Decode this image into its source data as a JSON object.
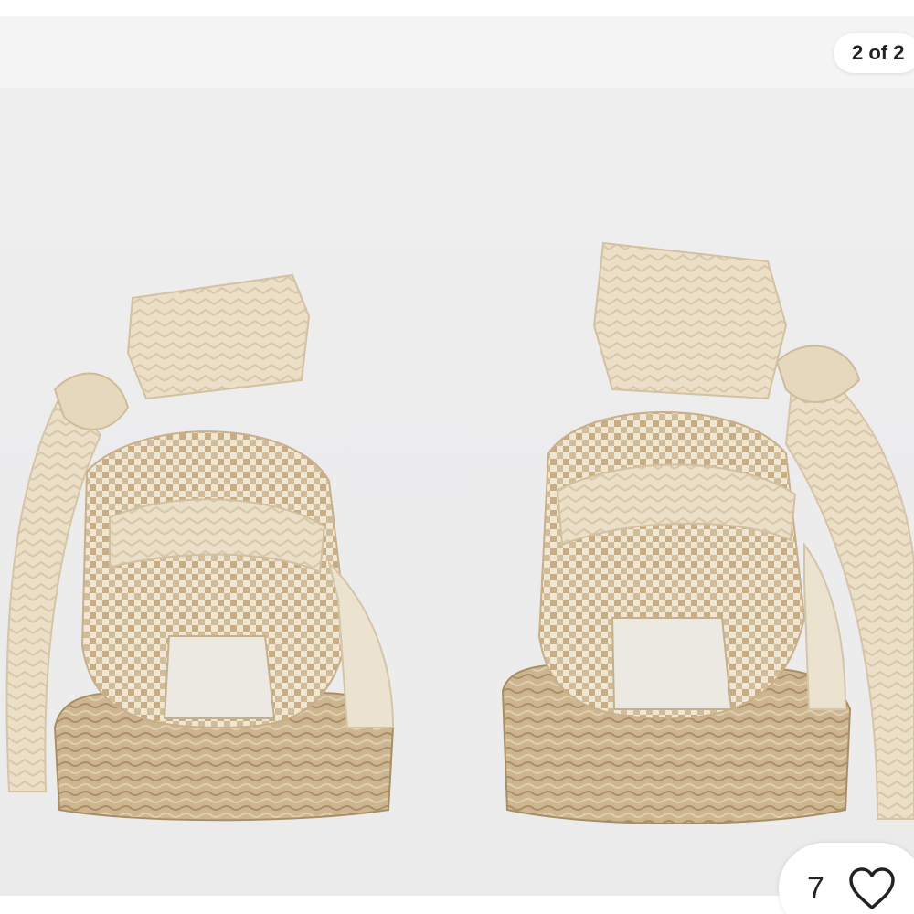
{
  "viewer": {
    "page_counter": "2 of 2",
    "likes_count": "7",
    "like_icon": "heart-outline-icon"
  },
  "photo": {
    "subject": "espadrille-sandals",
    "colors": {
      "ribbon": "#eadcc4",
      "ribbon_shadow": "#d4c3a6",
      "weave_light": "#f0e7d6",
      "weave_dark": "#c9b08a",
      "jute": "#cdb58f",
      "jute_dark": "#a88e66"
    }
  }
}
